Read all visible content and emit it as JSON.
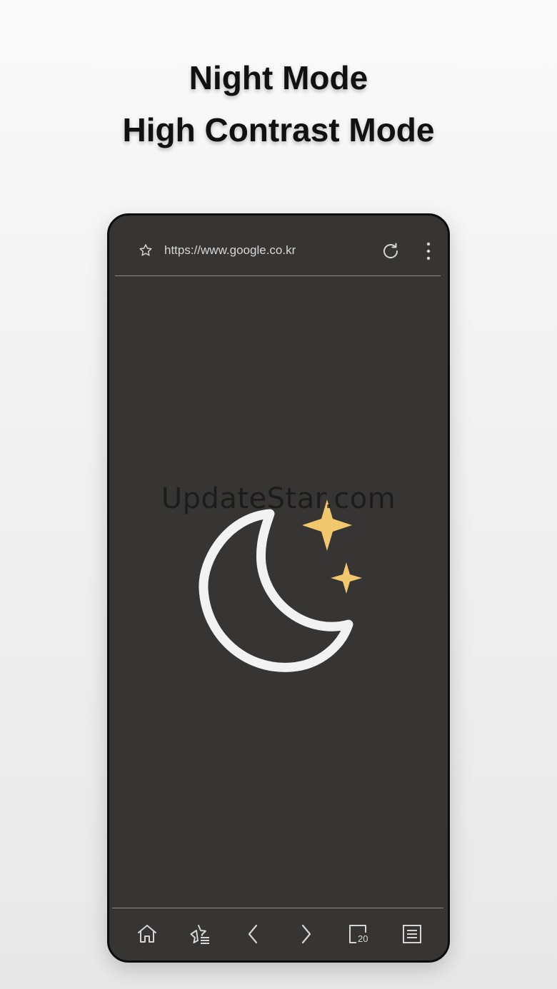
{
  "headline": {
    "line1": "Night Mode",
    "line2": "High Contrast Mode"
  },
  "browser": {
    "url": "https://www.google.co.kr",
    "icons": {
      "bookmark": "star-outline-icon",
      "reload": "reload-icon",
      "menu": "more-vertical-icon"
    }
  },
  "content": {
    "watermark": "UpdateStar.com",
    "illustration": {
      "moon_color": "#f2f2f2",
      "star_color": "#f2c86e"
    }
  },
  "bottom_nav": {
    "items": [
      {
        "name": "home",
        "icon": "home-icon"
      },
      {
        "name": "bookmarks",
        "icon": "bookmark-list-icon"
      },
      {
        "name": "back",
        "icon": "chevron-left-icon"
      },
      {
        "name": "forward",
        "icon": "chevron-right-icon"
      },
      {
        "name": "tabs",
        "icon": "tabs-icon"
      },
      {
        "name": "menu",
        "icon": "list-menu-icon"
      }
    ],
    "tab_count": "20"
  },
  "colors": {
    "page_background": "#f2f2f2",
    "phone_screen": "#363534",
    "phone_border": "#0d0d0d",
    "icon": "#d6d6d6",
    "headline_text": "#111111"
  }
}
